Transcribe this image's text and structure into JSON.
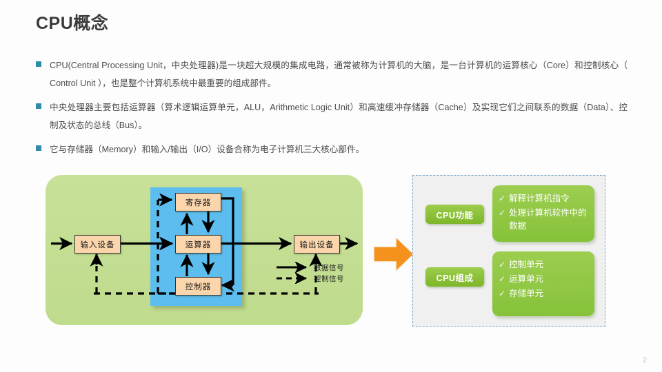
{
  "slide": {
    "title": "CPU概念",
    "page_number": "2",
    "accent_teal": "#2f8ba8",
    "accent_green": "#8cc63e",
    "accent_orange": "#f5921e",
    "panel_green_light": "#c3de92",
    "cpu_blue": "#5cbdee",
    "box_peach": "#fbd5ac"
  },
  "bullets": [
    {
      "marker": "square-bullet",
      "text": "CPU(Central Processing Unit，中央处理器)是一块超大规模的集成电路，通常被称为计算机的大脑，是一台计算机的运算核心（Core）和控制核心（ Control Unit ），也是整个计算机系统中最重要的组成部件。"
    },
    {
      "marker": "square-bullet",
      "text": "中央处理器主要包括运算器（算术逻辑运算单元，ALU，Arithmetic Logic Unit）和高速缓冲存储器（Cache）及实现它们之间联系的数据（Data）、控制及状态的总线（Bus）。"
    },
    {
      "marker": "square-bullet",
      "text": "它与存储器（Memory）和输入/输出（I/O）设备合称为电子计算机三大核心部件。"
    }
  ],
  "diagram": {
    "boxes": {
      "input": "输入设备",
      "output": "输出设备",
      "register": "寄存器",
      "alu": "运算器",
      "controller": "控制器"
    },
    "legend": [
      {
        "style": "solid",
        "label": "数据信号"
      },
      {
        "style": "dashed",
        "label": "控制信号"
      }
    ]
  },
  "right_panel": {
    "groups": [
      {
        "tag": "CPU功能",
        "items": [
          "解释计算机指令",
          "处理计算机软件中的数据"
        ]
      },
      {
        "tag": "CPU组成",
        "items": [
          "控制单元",
          "运算单元",
          "存储单元"
        ]
      }
    ]
  }
}
